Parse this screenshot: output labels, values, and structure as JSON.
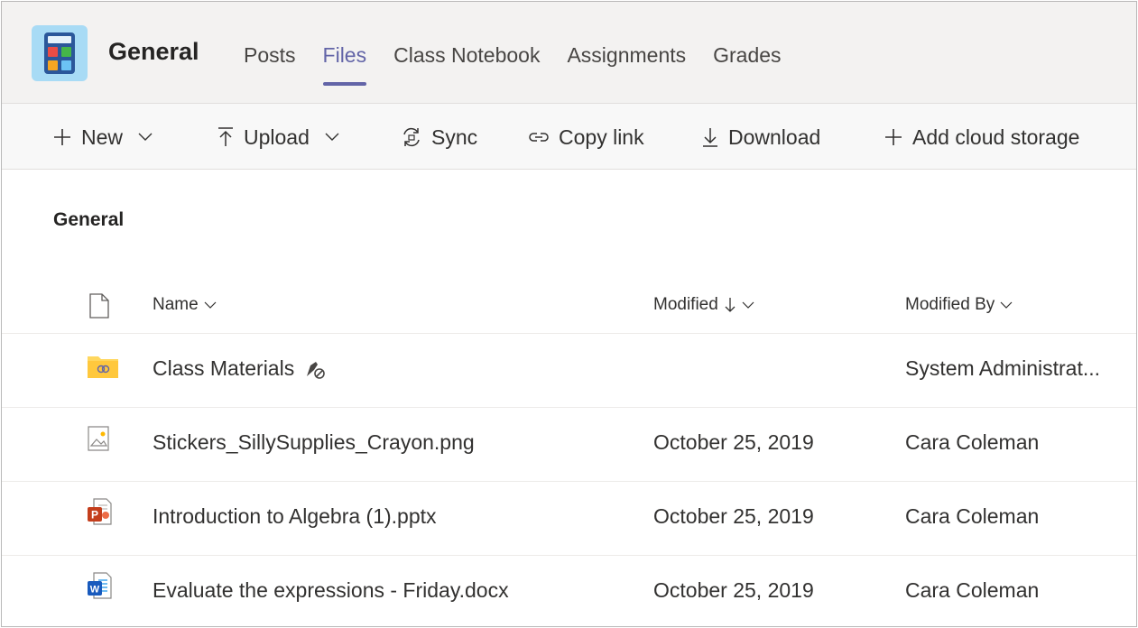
{
  "header": {
    "team_name": "General",
    "tabs": [
      "Posts",
      "Files",
      "Class Notebook",
      "Assignments",
      "Grades"
    ],
    "active_tab": "Files",
    "accent_color": "#6264a7"
  },
  "toolbar": {
    "new_label": "New",
    "upload_label": "Upload",
    "sync_label": "Sync",
    "copy_link_label": "Copy link",
    "download_label": "Download",
    "add_cloud_label": "Add cloud storage"
  },
  "section_title": "General",
  "table": {
    "columns": {
      "name": "Name",
      "modified": "Modified",
      "modified_by": "Modified By"
    },
    "rows": [
      {
        "icon": "folder-icon",
        "name": "Class Materials",
        "modified": "",
        "modified_by": "System Administrat..."
      },
      {
        "icon": "image-file-icon",
        "name": "Stickers_SillySupplies_Crayon.png",
        "modified": "October 25, 2019",
        "modified_by": "Cara Coleman"
      },
      {
        "icon": "powerpoint-file-icon",
        "name": "Introduction to Algebra (1).pptx",
        "modified": "October 25, 2019",
        "modified_by": "Cara Coleman"
      },
      {
        "icon": "word-file-icon",
        "name": "Evaluate the expressions - Friday.docx",
        "modified": "October 25, 2019",
        "modified_by": "Cara Coleman"
      }
    ]
  }
}
